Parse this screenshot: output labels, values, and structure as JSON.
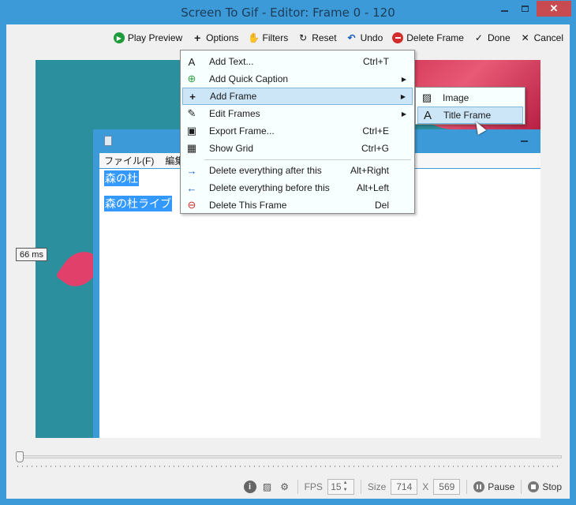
{
  "window": {
    "title": "Screen To Gif - Editor: Frame 0 - 120",
    "minimize_icon": "minimize-icon",
    "maximize_icon": "maximize-icon",
    "close_label": "✕"
  },
  "toolbar": {
    "play_preview": "Play Preview",
    "options": "Options",
    "filters": "Filters",
    "reset": "Reset",
    "undo": "Undo",
    "delete_frame": "Delete Frame",
    "done": "Done",
    "cancel": "Cancel"
  },
  "frame": {
    "delay": "66 ms",
    "notepad_menu": [
      "ファイル(F)",
      "編集(E)"
    ],
    "notepad_lines": [
      "森の杜",
      "森の杜ライブ"
    ]
  },
  "context_menu": {
    "items": [
      {
        "icon": "A",
        "label": "Add Text...",
        "shortcut": "Ctrl+T"
      },
      {
        "icon": "⊕",
        "label": "Add Quick Caption",
        "shortcut": "",
        "submenu": true
      },
      {
        "icon": "+",
        "label": "Add Frame",
        "shortcut": "",
        "submenu": true,
        "highlighted": true
      },
      {
        "icon": "✎",
        "label": "Edit Frames",
        "shortcut": "",
        "submenu": true
      },
      {
        "icon": "▣",
        "label": "Export Frame...",
        "shortcut": "Ctrl+E"
      },
      {
        "icon": "▦",
        "label": "Show Grid",
        "shortcut": "Ctrl+G"
      },
      {
        "icon": "→",
        "label": "Delete everything after this",
        "shortcut": "Alt+Right"
      },
      {
        "icon": "←",
        "label": "Delete everything before this",
        "shortcut": "Alt+Left"
      },
      {
        "icon": "⊖",
        "label": "Delete This Frame",
        "shortcut": "Del"
      }
    ]
  },
  "submenu": {
    "items": [
      {
        "icon": "▨",
        "label": "Image"
      },
      {
        "icon": "A",
        "label": "Title Frame",
        "highlighted": true
      }
    ]
  },
  "statusbar": {
    "fps_label": "FPS",
    "fps_value": "15",
    "size_label": "Size",
    "width": "714",
    "x_label": "X",
    "height": "569",
    "pause": "Pause",
    "stop": "Stop"
  },
  "colors": {
    "accent": "#3c9ad8",
    "close_button": "#c74b50",
    "menu_highlight": "#cde6f7",
    "selection": "#3399ff"
  }
}
